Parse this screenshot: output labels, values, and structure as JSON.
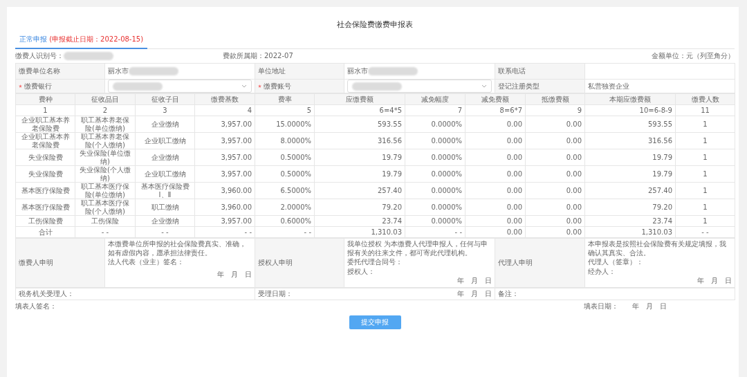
{
  "title": "社会保险费缴费申报表",
  "tab": {
    "label": "正常申报",
    "note": "(申报截止日期：2022-08-15)",
    "selected": true
  },
  "info_line": {
    "payer_id": {
      "label": "缴费人识别号：",
      "redacted": true
    },
    "period": "费款所属期：2022-07",
    "unit": "金额单位：元（列至角分）"
  },
  "info_rows": [
    {
      "cells": [
        {
          "label": "缴费单位名称",
          "required": false,
          "kind": "text",
          "value": "丽水市",
          "redacted": true
        },
        {
          "label": "单位地址",
          "required": false,
          "kind": "text",
          "value": "丽水市",
          "redacted": true
        },
        {
          "label": "联系电话",
          "required": false,
          "kind": "text"
        }
      ]
    },
    {
      "cells": [
        {
          "label": "缴费银行",
          "required": true,
          "kind": "select",
          "redacted": true
        },
        {
          "label": "缴费账号",
          "required": true,
          "kind": "select",
          "redacted": true
        },
        {
          "label": "登记注册类型",
          "required": false,
          "kind": "text",
          "value": "私营独资企业",
          "redacted": false
        }
      ]
    }
  ],
  "table": {
    "columns": [
      "费种",
      "征收品目",
      "征收子目",
      "缴费基数",
      "费率",
      "应缴费额",
      "减免幅度",
      "减免费额",
      "抵缴费额",
      "本期应缴费额",
      "缴费人数"
    ],
    "index_row": [
      "1",
      "2",
      "3",
      "4",
      "5",
      "6=4*5",
      "7",
      "8=6*7",
      "9",
      "10=6-8-9",
      "11"
    ],
    "rows": [
      [
        "企业职工基本养老保险费",
        "职工基本养老保险(单位缴纳)",
        "企业缴纳",
        "3,957.00",
        "15.0000%",
        "593.55",
        "0.0000%",
        "0.00",
        "0.00",
        "593.55",
        "1"
      ],
      [
        "企业职工基本养老保险费",
        "职工基本养老保险(个人缴纳)",
        "企业职工缴纳",
        "3,957.00",
        "8.0000%",
        "316.56",
        "0.0000%",
        "0.00",
        "0.00",
        "316.56",
        "1"
      ],
      [
        "失业保险费",
        "失业保险(单位缴纳)",
        "企业缴纳",
        "3,957.00",
        "0.5000%",
        "19.79",
        "0.0000%",
        "0.00",
        "0.00",
        "19.79",
        "1"
      ],
      [
        "失业保险费",
        "失业保险(个人缴纳)",
        "企业职工缴纳",
        "3,957.00",
        "0.5000%",
        "19.79",
        "0.0000%",
        "0.00",
        "0.00",
        "19.79",
        "1"
      ],
      [
        "基本医疗保险费",
        "职工基本医疗保险(单位缴纳)",
        "基本医疗保险费Ⅰ、Ⅱ",
        "3,960.00",
        "6.5000%",
        "257.40",
        "0.0000%",
        "0.00",
        "0.00",
        "257.40",
        "1"
      ],
      [
        "基本医疗保险费",
        "职工基本医疗保险(个人缴纳)",
        "职工缴纳",
        "3,960.00",
        "2.0000%",
        "79.20",
        "0.0000%",
        "0.00",
        "0.00",
        "79.20",
        "1"
      ],
      [
        "工伤保险费",
        "工伤保险",
        "企业缴纳",
        "3,957.00",
        "0.6000%",
        "23.74",
        "0.0000%",
        "0.00",
        "0.00",
        "23.74",
        "1"
      ],
      [
        "合计",
        "- -",
        "- -",
        "- -",
        "- -",
        "1,310.03",
        "- -",
        "0.00",
        "0.00",
        "1,310.03",
        "- -"
      ]
    ]
  },
  "declarations": [
    {
      "label": "缴费人申明",
      "lines": [
        "本缴费单位所申报的社会保险费真实、准确，如有虚假内容，愿承担法律责任。",
        "法人代表（业主）签名："
      ],
      "date": [
        "年",
        "月",
        "日"
      ]
    },
    {
      "label": "授权人申明",
      "lines": [
        "我单位授权 为本缴费人代理申报人，任何与申报有关的往来文件，都可寄此代理机构。",
        "委托代理合同号：",
        "授权人："
      ],
      "date": [
        "年",
        "月",
        "日"
      ]
    },
    {
      "label": "代理人申明",
      "lines": [
        "本申报表是按照社会保险费有关规定填报，我确认其真实、合法。",
        "代理人（签章）：",
        "经办人："
      ],
      "date": [
        "年",
        "月",
        "日"
      ]
    }
  ],
  "acceptance": {
    "accepter": "税务机关受理人：",
    "accept_date": {
      "label": "受理日期：",
      "date": [
        "年",
        "月",
        "日"
      ]
    },
    "remark": "备注："
  },
  "footer": {
    "filler": "填表人签名：",
    "fill_date": {
      "label": "填表日期：",
      "date": [
        "年",
        "月",
        "日"
      ]
    }
  },
  "submit_button": "提交申报"
}
